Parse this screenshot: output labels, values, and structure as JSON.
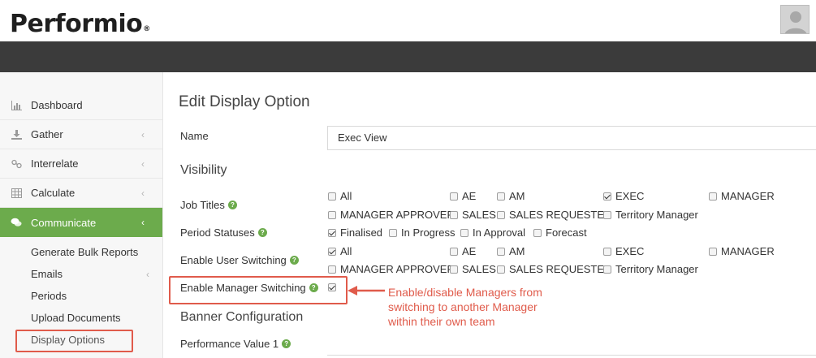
{
  "brand": {
    "logo_text": "Performio",
    "registered_mark": "®"
  },
  "colors": {
    "accent": "#6cab4c",
    "header_dark": "#3b3b3b",
    "annotation": "#e05b4b"
  },
  "sidebar": {
    "items": [
      {
        "label": "Dashboard",
        "icon": "bar-chart-icon",
        "has_chevron": false
      },
      {
        "label": "Gather",
        "icon": "download-icon",
        "has_chevron": true
      },
      {
        "label": "Interrelate",
        "icon": "link-icon",
        "has_chevron": true
      },
      {
        "label": "Calculate",
        "icon": "table-icon",
        "has_chevron": true
      },
      {
        "label": "Communicate",
        "icon": "chat-icon",
        "has_chevron": true,
        "active": true
      }
    ],
    "subitems": [
      {
        "label": "Generate Bulk Reports"
      },
      {
        "label": "Emails",
        "has_chevron": true
      },
      {
        "label": "Periods"
      },
      {
        "label": "Upload Documents"
      },
      {
        "label": "Display Options",
        "selected": true
      }
    ]
  },
  "main": {
    "title": "Edit Display Option",
    "name_label": "Name",
    "name_value": "Exec View",
    "visibility_heading": "Visibility",
    "job_titles_label": "Job Titles",
    "job_titles": [
      {
        "label": "All",
        "checked": false
      },
      {
        "label": "AE",
        "checked": false
      },
      {
        "label": "AM",
        "checked": false
      },
      {
        "label": "EXEC",
        "checked": true
      },
      {
        "label": "MANAGER",
        "checked": false
      },
      {
        "label": "MANAGER APPROVER",
        "checked": false
      },
      {
        "label": "SALES",
        "checked": false
      },
      {
        "label": "SALES REQUESTER",
        "checked": false
      },
      {
        "label": "Territory Manager",
        "checked": false
      }
    ],
    "period_statuses_label": "Period Statuses",
    "period_statuses": [
      {
        "label": "Finalised",
        "checked": true
      },
      {
        "label": "In Progress",
        "checked": false
      },
      {
        "label": "In Approval",
        "checked": false
      },
      {
        "label": "Forecast",
        "checked": false
      }
    ],
    "user_switching_label": "Enable User Switching",
    "user_switching": [
      {
        "label": "All",
        "checked": true
      },
      {
        "label": "AE",
        "checked": false
      },
      {
        "label": "AM",
        "checked": false
      },
      {
        "label": "EXEC",
        "checked": false
      },
      {
        "label": "MANAGER",
        "checked": false
      },
      {
        "label": "MANAGER APPROVER",
        "checked": false
      },
      {
        "label": "SALES",
        "checked": false
      },
      {
        "label": "SALES REQUESTER",
        "checked": false
      },
      {
        "label": "Territory Manager",
        "checked": false
      }
    ],
    "manager_switching_label": "Enable Manager Switching",
    "manager_switching_checked": true,
    "banner_heading": "Banner Configuration",
    "performance_value_label": "Performance Value 1"
  },
  "annotation": {
    "line1": "Enable/disable Managers from",
    "line2": "switching to another Manager",
    "line3": "within their own team"
  }
}
